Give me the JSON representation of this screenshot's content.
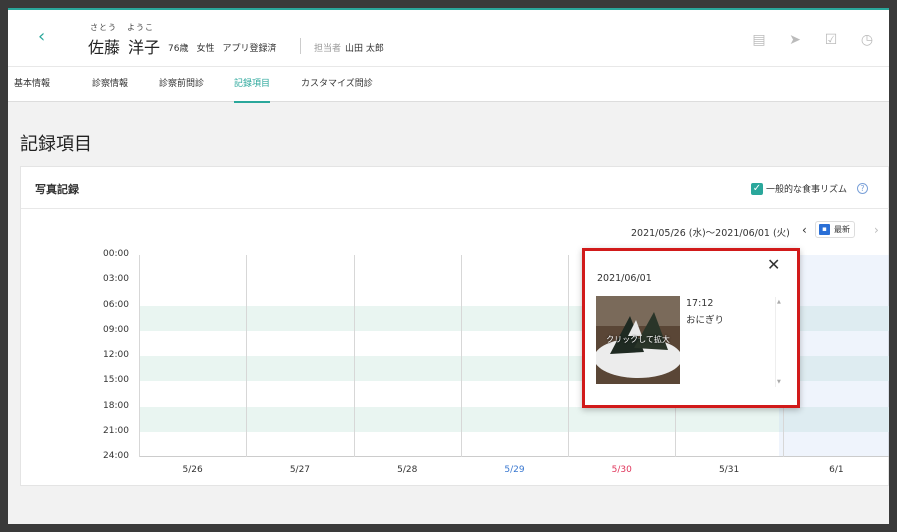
{
  "header": {
    "back_icon": "chevron-left-icon",
    "kana_last": "さとう",
    "kana_first": "ようこ",
    "last_name": "佐藤",
    "first_name": "洋子",
    "age": "76歳",
    "gender": "女性",
    "app_status": "アプリ登録済",
    "staff_label": "担当者",
    "staff_name": "山田 太郎",
    "icons": [
      "document-icon",
      "send-icon",
      "calendar-check-icon",
      "clock-list-icon"
    ]
  },
  "tabs": [
    {
      "label": "基本情報",
      "active": false
    },
    {
      "label": "診察情報",
      "active": false
    },
    {
      "label": "診察前問診",
      "active": false
    },
    {
      "label": "記録項目",
      "active": true
    },
    {
      "label": "カスタマイズ問診",
      "active": false
    }
  ],
  "page": {
    "title": "記録項目"
  },
  "card": {
    "title": "写真記録",
    "rhythm_checkbox_checked": true,
    "rhythm_label": "一般的な食事リズム",
    "help_icon": "question-circle-icon"
  },
  "range": {
    "text": "2021/05/26 (水)〜2021/06/01 (火)",
    "prev_icon": "chevron-left-icon",
    "latest_label": "最新",
    "next_icon": "chevron-right-icon"
  },
  "chart_data": {
    "type": "scatter",
    "y_ticks": [
      "00:00",
      "03:00",
      "06:00",
      "09:00",
      "12:00",
      "15:00",
      "18:00",
      "21:00",
      "24:00"
    ],
    "x_categories": [
      "5/26",
      "5/27",
      "5/28",
      "5/29",
      "5/30",
      "5/31",
      "6/1"
    ],
    "x_category_colors": [
      "#333333",
      "#333333",
      "#333333",
      "#3a78d0",
      "#e0345a",
      "#333333",
      "#333333"
    ],
    "meal_rhythm_bands_hours": [
      [
        6,
        9
      ],
      [
        12,
        15
      ],
      [
        18,
        21
      ]
    ],
    "points": [
      {
        "date": "6/1",
        "time": "17:12",
        "label": "おにぎり"
      }
    ]
  },
  "popup": {
    "date": "2021/06/01",
    "time": "17:12",
    "name": "おにぎり",
    "zoom_label": "クリックして拡大",
    "close_icon": "close-icon"
  },
  "colors": {
    "accent": "#2aa79b",
    "highlight_border": "#d11a1a",
    "band": "#e9f5f1"
  }
}
